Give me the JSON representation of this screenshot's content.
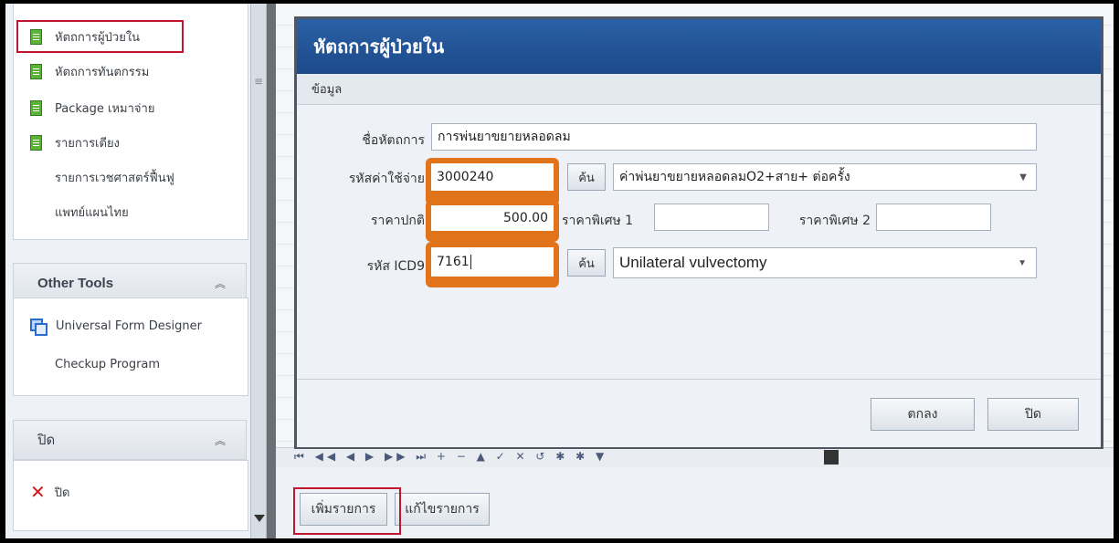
{
  "sidebar": {
    "items": [
      {
        "label": "หัตถการผู้ป่วยใน"
      },
      {
        "label": "หัตถการทันตกรรม"
      },
      {
        "label": "Package เหมาจ่าย"
      },
      {
        "label": "รายการเตียง"
      },
      {
        "label": "รายการเวชศาสตร์ฟื้นฟู"
      },
      {
        "label": "แพทย์แผนไทย"
      }
    ],
    "other_tools": {
      "title": "Other Tools",
      "items": [
        {
          "label": "Universal Form Designer"
        },
        {
          "label": "Checkup Program"
        }
      ]
    },
    "close_panel": {
      "title": "ปิด",
      "item_label": "ปิด"
    }
  },
  "dialog": {
    "title": "หัตถการผู้ป่วยใน",
    "tab": "ข้อมูล",
    "fields": {
      "procedure_name": {
        "label": "ชื่อหัตถการ",
        "value": "การพ่นยาขยายหลอดลม"
      },
      "expense_code": {
        "label": "รหัสค่าใช้จ่าย",
        "value": "3000240",
        "search": "ค้น",
        "select_value": "ค่าพ่นยาขยายหลอดลมO2+สาย+ ต่อครั้ง"
      },
      "normal_price": {
        "label": "ราคาปกติ",
        "value": "500.00"
      },
      "special_price_1": {
        "label": "ราคาพิเศษ 1",
        "value": ""
      },
      "special_price_2": {
        "label": "ราคาพิเศษ 2",
        "value": ""
      },
      "icd9": {
        "label": "รหัส ICD9",
        "value": "7161",
        "search": "ค้น",
        "select_value": "Unilateral vulvectomy"
      }
    },
    "ok_label": "ตกลง",
    "close_label": "ปิด"
  },
  "bottom": {
    "add_label": "เพิ่มรายการ",
    "edit_label": "แก้ไขรายการ"
  },
  "navigator": {
    "glyphs": "⏮ ◀◀ ◀ ▶ ▶▶ ⏭ + − ▲ ✓ ✕ ↺ ✱ ✱ ▼"
  },
  "colors": {
    "title_bar": "#2a60a6",
    "highlight_orange": "#e1741b",
    "selection_red": "#c0162d"
  }
}
